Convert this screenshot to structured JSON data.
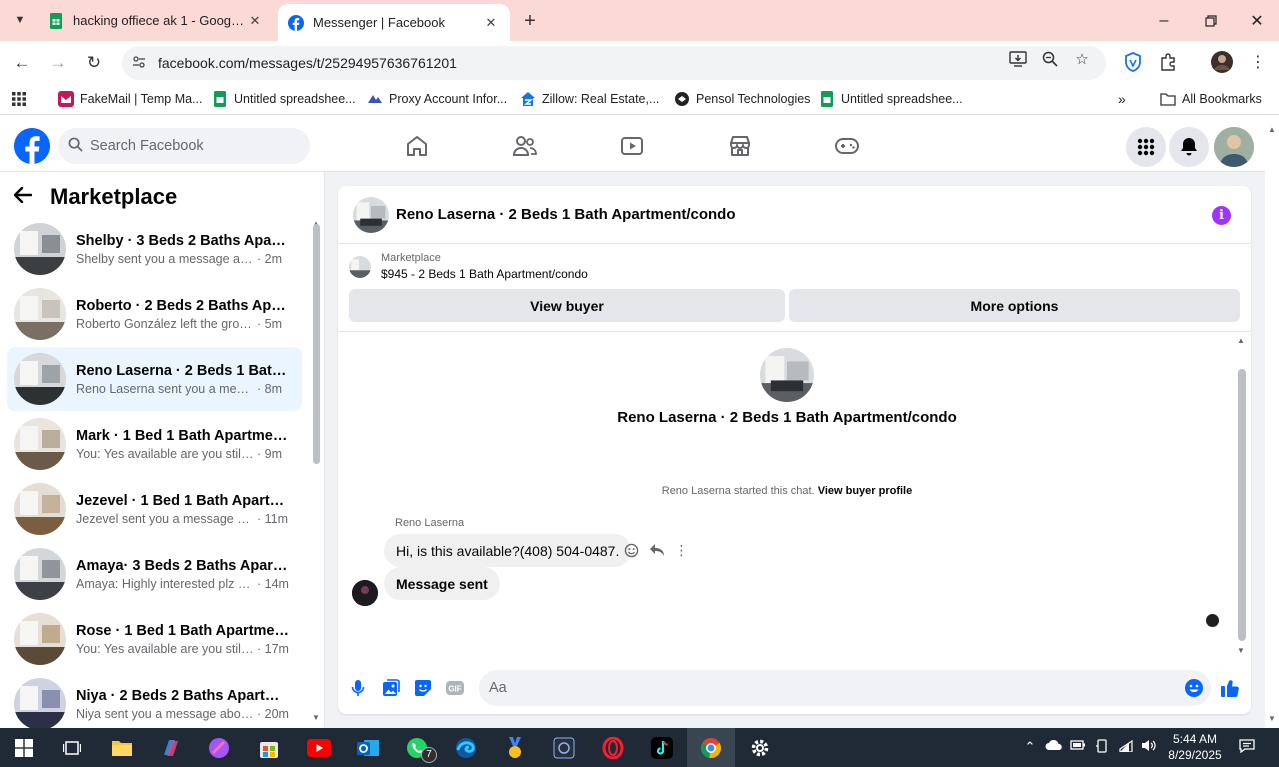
{
  "browser": {
    "tabs": [
      {
        "title": "hacking offiece ak 1 - Google S",
        "active": false
      },
      {
        "title": "Messenger | Facebook",
        "active": true
      }
    ],
    "url": "facebook.com/messages/t/25294957636761201",
    "bookmarks": [
      {
        "label": "FakeMail | Temp Ma..."
      },
      {
        "label": "Untitled spreadshee..."
      },
      {
        "label": "Proxy Account Infor..."
      },
      {
        "label": "Zillow: Real Estate,..."
      },
      {
        "label": "Pensol Technologies"
      },
      {
        "label": "Untitled spreadshee..."
      }
    ],
    "all_bookmarks": "All Bookmarks"
  },
  "fb": {
    "search_placeholder": "Search Facebook",
    "brand_color": "#0866ff"
  },
  "sidebar": {
    "title": "Marketplace",
    "chats": [
      {
        "name": "Shelby · 3 Beds 2 Baths Apartm...",
        "preview": "Shelby sent you a message about ...",
        "time": "· 2m",
        "selected": false
      },
      {
        "name": "Roberto · 2 Beds 2 Baths Apart...",
        "preview": "Roberto González left the group.",
        "time": "· 5m",
        "selected": false
      },
      {
        "name": "Reno Laserna · 2 Beds 1 Bath Ap...",
        "preview": "Reno Laserna sent you a message ...",
        "time": "· 8m",
        "selected": true
      },
      {
        "name": "Mark · 1 Bed 1 Bath Apartment/...",
        "preview": "You: Yes available are you still inter...",
        "time": "· 9m",
        "selected": false
      },
      {
        "name": "Jezevel · 1 Bed 1 Bath Apartmen...",
        "preview": "Jezevel sent you a message abou...",
        "time": "· 11m",
        "selected": false
      },
      {
        "name": "Amaya· 3 Beds 2 Baths Apartme...",
        "preview": "Amaya: Highly interested plz con...",
        "time": "· 14m",
        "selected": false
      },
      {
        "name": "Rose · 1 Bed 1 Bath Apartment/c...",
        "preview": "You: Yes available are you still int...",
        "time": "· 17m",
        "selected": false
      },
      {
        "name": "Niya · 2 Beds 2 Baths Apartmen...",
        "preview": "Niya sent you a message about y...",
        "time": "· 20m",
        "selected": false
      }
    ]
  },
  "conversation": {
    "title": "Reno Laserna · 2 Beds 1 Bath Apartment/condo",
    "listing_source": "Marketplace",
    "listing_price": "$945 - 2 Beds 1 Bath Apartment/condo",
    "view_buyer": "View buyer",
    "more_options": "More options",
    "intro_title": "Reno Laserna · 2 Beds 1 Bath Apartment/condo",
    "started_text": "Reno Laserna started this chat.",
    "view_profile": "View buyer profile",
    "sender": "Reno Laserna",
    "messages": [
      {
        "text": "Hi, is this available?(408) 504-0487."
      },
      {
        "text": "Message sent"
      }
    ],
    "composer_placeholder": "Aa"
  },
  "taskbar": {
    "time": "5:44 AM",
    "date": "8/29/2025",
    "whatsapp_badge": "7"
  }
}
